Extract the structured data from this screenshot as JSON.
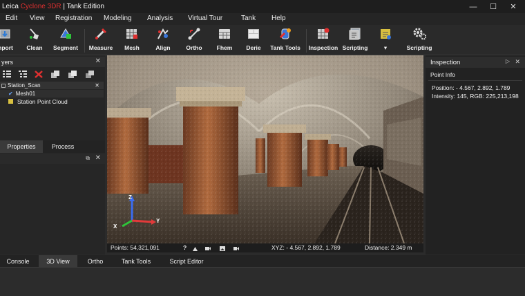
{
  "window": {
    "title_brand": "Leica ",
    "title_product_a": "Cyclone ",
    "title_product_b": "3DR",
    "title_edition": " | Tank Edition",
    "minimize": "—",
    "maximize": "☐",
    "close": "✕"
  },
  "menu": [
    "Edit",
    "View",
    "Registration",
    "Modeling",
    "Analysis",
    "Virtual Tour",
    "Tank",
    "Help"
  ],
  "toolbar": [
    {
      "label": "nport",
      "icon": "import-icon"
    },
    {
      "label": "Clean",
      "icon": "clean-icon"
    },
    {
      "label": "Segment",
      "icon": "segment-icon"
    },
    {
      "label": "Measure",
      "icon": "measure-icon"
    },
    {
      "label": "Mesh",
      "icon": "mesh-icon"
    },
    {
      "label": "Align",
      "icon": "align-icon"
    },
    {
      "label": "Ortho",
      "icon": "ortho-icon"
    },
    {
      "label": "Fhem",
      "icon": "fhem-icon"
    },
    {
      "label": "Derie",
      "icon": "derie-icon"
    },
    {
      "label": "Tank Tools",
      "icon": "tank-tools-icon"
    },
    {
      "label": "Inspection",
      "icon": "inspection-icon"
    },
    {
      "label": "Scripting",
      "icon": "scripting-icon"
    },
    {
      "label": "▾",
      "icon": "dropdown-tool-icon"
    },
    {
      "label": "Scripting",
      "icon": "scripting-gear-icon"
    }
  ],
  "layers_panel": {
    "title": "yers",
    "close": "✕",
    "tree": [
      {
        "label": "Station_Scan",
        "close": "✕"
      },
      {
        "label": "Mesh01",
        "checked": true
      },
      {
        "label": "Station Point Cloud"
      }
    ]
  },
  "left_tabs": [
    "Properties",
    "Process"
  ],
  "props_controls": {
    "undock": "⧉",
    "close": "✕"
  },
  "axes": {
    "z": "Z",
    "x": "X",
    "y": "Y"
  },
  "status": {
    "points": "Points: 54,321,091",
    "help": "?",
    "xyz": "XYZ: - 4.567, 2.892, 1.789",
    "distance": "Distance: 2.349 m"
  },
  "inspection_panel": {
    "title": "Inspection",
    "undock": "▷",
    "close": "✕",
    "section": "Point Info",
    "position": "Position: - 4.567, 2.892, 1.789",
    "intensity": "Intensity: 145, RGB: 225,213,198"
  },
  "bottom_tabs": [
    "Console",
    "3D View",
    "Ortho",
    "Tank Tools",
    "Script Editor"
  ],
  "colors": {
    "accent_red": "#e03030",
    "axis_x": "#e23a3a",
    "axis_y": "#2ec43a",
    "axis_z": "#3a6cf0"
  }
}
